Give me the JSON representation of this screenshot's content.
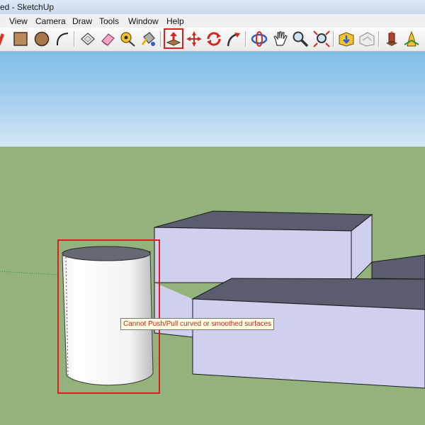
{
  "window": {
    "title": "ed - SketchUp"
  },
  "menu": {
    "items": [
      "View",
      "Camera",
      "Draw",
      "Tools",
      "Window",
      "Help"
    ]
  },
  "toolbar": {
    "tools": [
      {
        "name": "pencil-icon"
      },
      {
        "name": "rectangle-icon"
      },
      {
        "name": "circle-icon"
      },
      {
        "name": "arc-icon"
      },
      {
        "name": "make-component-icon"
      },
      {
        "name": "eraser-icon"
      },
      {
        "name": "tape-measure-icon"
      },
      {
        "name": "paint-bucket-icon"
      },
      {
        "name": "push-pull-icon",
        "selected": true
      },
      {
        "name": "move-icon"
      },
      {
        "name": "rotate-icon"
      },
      {
        "name": "follow-me-icon"
      },
      {
        "name": "orbit-icon"
      },
      {
        "name": "pan-icon"
      },
      {
        "name": "zoom-icon"
      },
      {
        "name": "zoom-extents-icon"
      },
      {
        "name": "get-models-icon"
      },
      {
        "name": "share-model-icon"
      },
      {
        "name": "components-icon"
      },
      {
        "name": "extension-icon"
      }
    ]
  },
  "viewport": {
    "tooltip": "Cannot Push/Pull curved or smoothed surfaces",
    "sky_color": "#a9d1ef",
    "ground_color": "#94b27b",
    "face_color": "#cfcfee",
    "top_color": "#5a5d6e",
    "highlight_color": "#e01d1d"
  }
}
